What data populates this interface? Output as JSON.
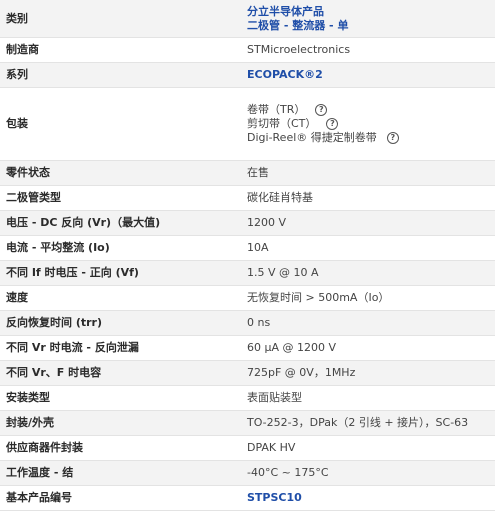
{
  "rows": [
    {
      "label": "类别",
      "lines": [
        "分立半导体产品",
        "二极管 - 整流器 - 单"
      ],
      "link": true
    },
    {
      "label": "制造商",
      "value": "STMicroelectronics"
    },
    {
      "label": "系列",
      "value": "ECOPACK®2",
      "link": true
    },
    {
      "label": "包装",
      "options": [
        {
          "text": "卷带（TR）"
        },
        {
          "text": "剪切带（CT）"
        },
        {
          "text": "Digi-Reel® 得捷定制卷带"
        }
      ]
    },
    {
      "label": "零件状态",
      "value": "在售"
    },
    {
      "label": "二极管类型",
      "value": "碳化硅肖特基"
    },
    {
      "label": "电压 - DC 反向 (Vr)（最大值)",
      "value": "1200 V"
    },
    {
      "label": "电流 - 平均整流 (Io)",
      "value": "10A"
    },
    {
      "label": "不同 If 时电压 - 正向 (Vf)",
      "value": "1.5 V @ 10 A"
    },
    {
      "label": "速度",
      "value": "无恢复时间 > 500mA（Io）"
    },
    {
      "label": "反向恢复时间 (trr)",
      "value": "0 ns"
    },
    {
      "label": "不同 Vr 时电流 - 反向泄漏",
      "value": "60 µA @ 1200 V"
    },
    {
      "label": "不同 Vr、F 时电容",
      "value": "725pF @ 0V，1MHz"
    },
    {
      "label": "安装类型",
      "value": "表面贴装型"
    },
    {
      "label": "封装/外壳",
      "value": "TO-252-3，DPak（2 引线 + 接片），SC-63"
    },
    {
      "label": "供应商器件封装",
      "value": "DPAK HV"
    },
    {
      "label": "工作温度 - 结",
      "value": "-40°C ~ 175°C"
    },
    {
      "label": "基本产品编号",
      "value": "STPSC10",
      "link": true
    }
  ],
  "help_icon_glyph": "?",
  "colors": {
    "link": "#1f4ea8",
    "row_alt": "#f3f3f3",
    "border": "#e3e3e3"
  }
}
